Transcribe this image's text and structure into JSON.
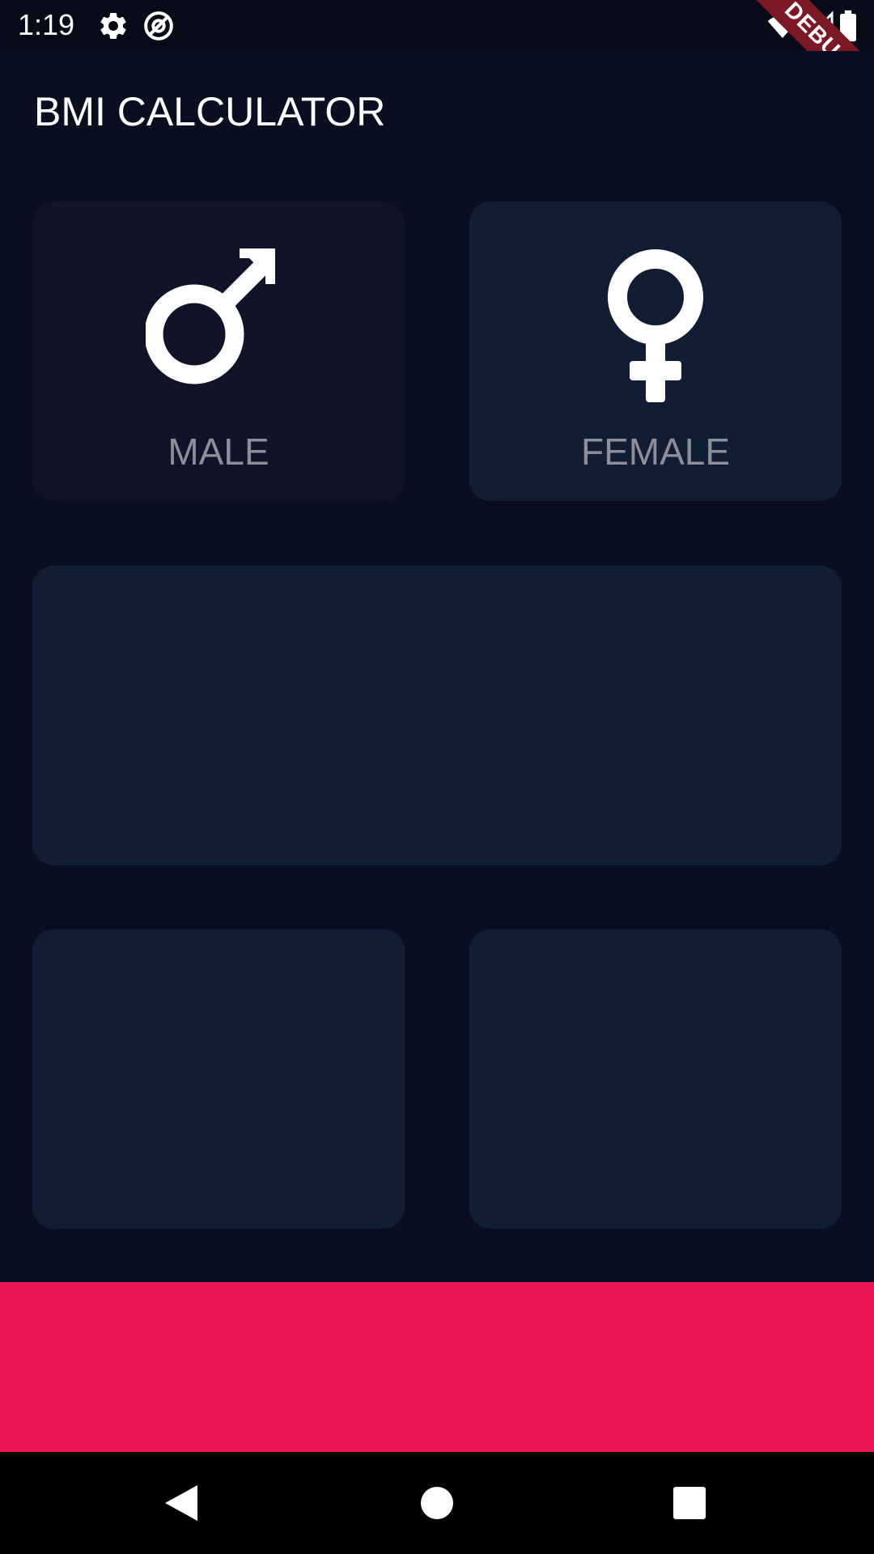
{
  "status_bar": {
    "time": "1:19",
    "icons_left": [
      "gear-icon",
      "at-sign-icon"
    ],
    "icons_right": [
      "wifi-icon",
      "signal-icon",
      "battery-icon"
    ],
    "debug_label": "DEBUG"
  },
  "app_bar": {
    "title": "BMI CALCULATOR"
  },
  "gender_cards": {
    "male": {
      "label": "MALE",
      "icon": "male-icon",
      "selected": false
    },
    "female": {
      "label": "FEMALE",
      "icon": "female-icon",
      "selected": true
    }
  },
  "colors": {
    "background": "#0a0e21",
    "active_card": "#111d33",
    "inactive_card": "#111328",
    "label": "#8d8e98",
    "accent": "#eb1555",
    "debug_banner": "#7d1826"
  },
  "nav_bar": {
    "buttons": [
      "back-icon",
      "home-icon",
      "recents-icon"
    ]
  }
}
